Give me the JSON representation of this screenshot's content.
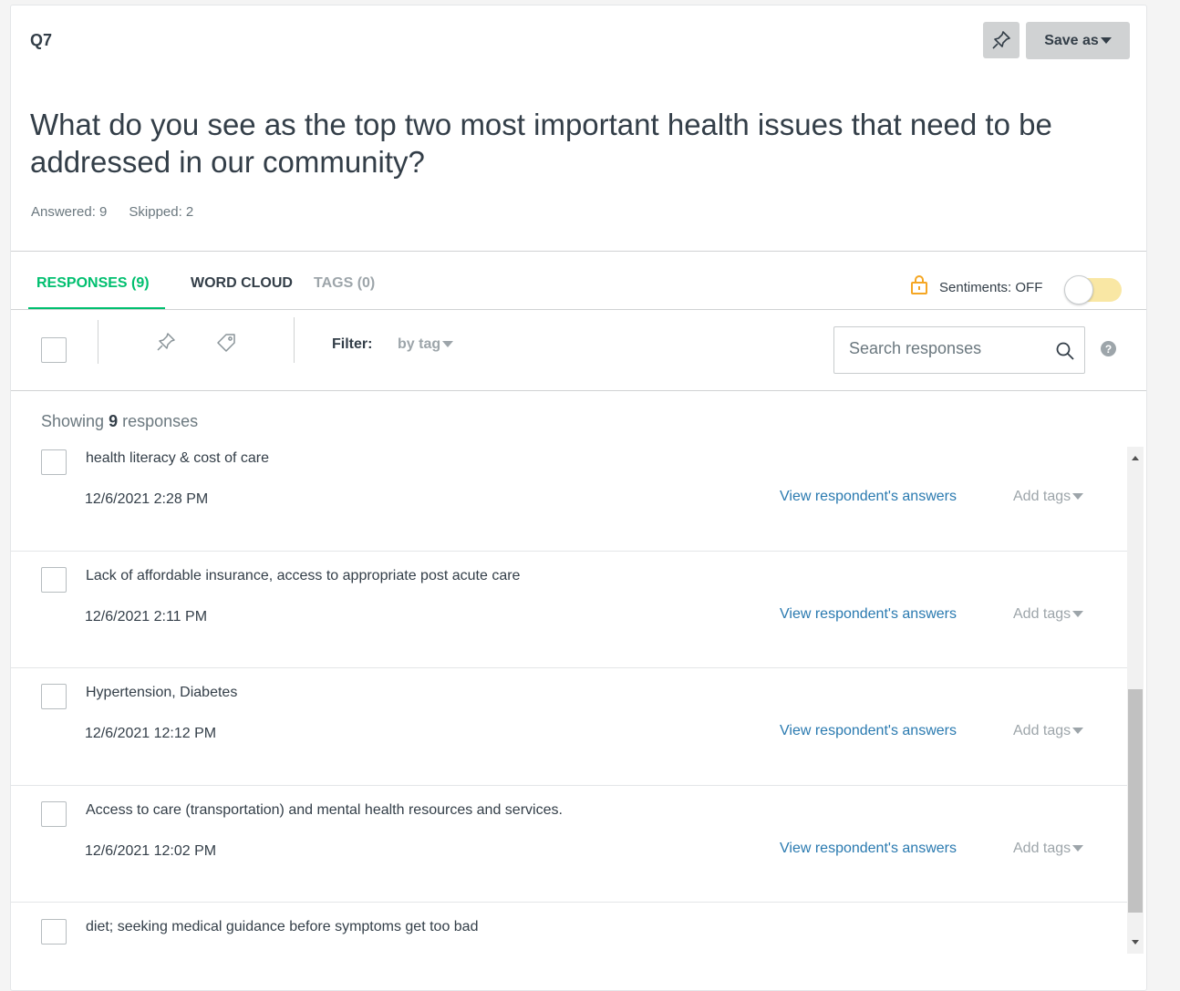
{
  "question": {
    "number": "Q7",
    "text": "What do you see as the top two most important health issues that need to be addressed in our community?",
    "answered": "Answered: 9",
    "skipped": "Skipped: 2"
  },
  "header": {
    "save_as_label": "Save as"
  },
  "tabs": {
    "responses": "RESPONSES (9)",
    "word_cloud": "WORD CLOUD",
    "tags": "TAGS (0)"
  },
  "sentiments": {
    "label": "Sentiments: OFF",
    "enabled": false
  },
  "toolbar": {
    "filter_label": "Filter:",
    "filter_value": "by tag",
    "search_placeholder": "Search responses"
  },
  "showing": {
    "prefix": "Showing",
    "count": "9",
    "suffix": "responses"
  },
  "responses": [
    {
      "text": "health literacy & cost of care",
      "date": "12/6/2021 2:28 PM",
      "view_label": "View respondent's answers",
      "tags_label": "Add tags"
    },
    {
      "text": "Lack of affordable insurance, access to appropriate post acute care",
      "date": "12/6/2021 2:11 PM",
      "view_label": "View respondent's answers",
      "tags_label": "Add tags"
    },
    {
      "text": "Hypertension, Diabetes",
      "date": "12/6/2021 12:12 PM",
      "view_label": "View respondent's answers",
      "tags_label": "Add tags"
    },
    {
      "text": "Access to care (transportation) and mental health resources and services.",
      "date": "12/6/2021 12:02 PM",
      "view_label": "View respondent's answers",
      "tags_label": "Add tags"
    },
    {
      "text": "diet; seeking medical guidance before symptoms get too bad"
    }
  ],
  "colors": {
    "accent": "#00bf6f",
    "link": "#2a7ab0",
    "muted": "#9da5aa",
    "lock": "#f5a623"
  }
}
